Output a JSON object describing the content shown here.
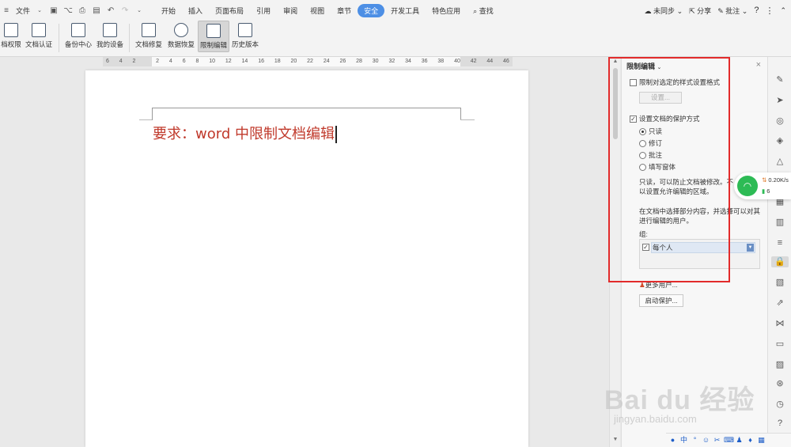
{
  "menubar": {
    "file_label": "文件",
    "items": [
      "开始",
      "插入",
      "页面布局",
      "引用",
      "审阅",
      "视图",
      "章节",
      "安全",
      "开发工具",
      "特色应用"
    ],
    "active_item": "安全",
    "search_label": "查找",
    "sync_label": "未同步",
    "share_label": "分享",
    "comment_label": "批注"
  },
  "ribbon": {
    "buttons": [
      "档权限",
      "文档认证",
      "备份中心",
      "我的设备",
      "文档修复",
      "数据恢复",
      "限制编辑",
      "历史版本"
    ],
    "selected": "限制编辑"
  },
  "ruler": {
    "numbers": [
      "6",
      "4",
      "2",
      "",
      "2",
      "4",
      "6",
      "8",
      "10",
      "12",
      "14",
      "16",
      "18",
      "20",
      "22",
      "24",
      "26",
      "28",
      "30",
      "32",
      "34",
      "36",
      "38",
      "40",
      "42",
      "44",
      "46"
    ]
  },
  "document": {
    "text": "要求：word 中限制文档编辑"
  },
  "pane": {
    "title": "限制编辑",
    "format_restrict_label": "限制对选定的样式设置格式",
    "settings_button": "设置...",
    "protect_label": "设置文档的保护方式",
    "options": [
      "只读",
      "修订",
      "批注",
      "填写窗体"
    ],
    "selected_option": "只读",
    "desc1": "只读，可以防止文档被修改。不",
    "desc2": "以设置允许编辑的区域。",
    "desc3": "在文档中选择部分内容，并选择可以对其",
    "desc4": "进行编辑的用户。",
    "group_label": "组:",
    "group_value": "每个人",
    "more_users": "更多用户...",
    "start_protect": "启动保护..."
  },
  "wifi": {
    "speed": "0.20K/s",
    "count": "6"
  },
  "watermark": {
    "main": "Bai du 经验",
    "sub": "jingyan.baidu.com"
  }
}
